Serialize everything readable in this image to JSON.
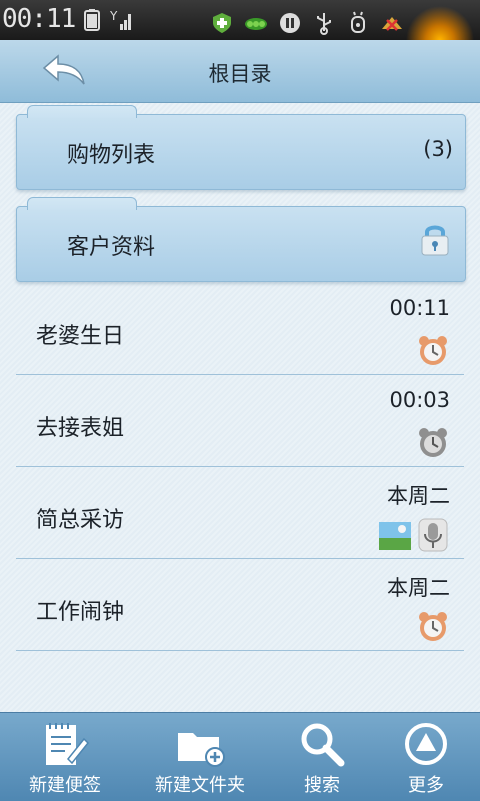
{
  "status": {
    "time": "00:11"
  },
  "header": {
    "title": "根目录"
  },
  "folders": [
    {
      "name": "购物列表",
      "count": "(3)",
      "locked": false
    },
    {
      "name": "客户资料",
      "count": "",
      "locked": true
    }
  ],
  "notes": [
    {
      "title": "老婆生日",
      "time": "00:11",
      "icons": [
        "alarm-icon"
      ]
    },
    {
      "title": "去接表姐",
      "time": "00:03",
      "icons": [
        "alarm-disabled-icon"
      ]
    },
    {
      "title": "简总采访",
      "time": "本周二",
      "icons": [
        "image-icon",
        "microphone-icon"
      ]
    },
    {
      "title": "工作闹钟",
      "time": "本周二",
      "icons": [
        "alarm-icon"
      ]
    }
  ],
  "toolbar": {
    "new_note": "新建便签",
    "new_folder": "新建文件夹",
    "search": "搜索",
    "more": "更多"
  },
  "colors": {
    "header": "#a8cbe3",
    "toolbar": "#5f95bd",
    "alarm": "#e79a6a"
  }
}
